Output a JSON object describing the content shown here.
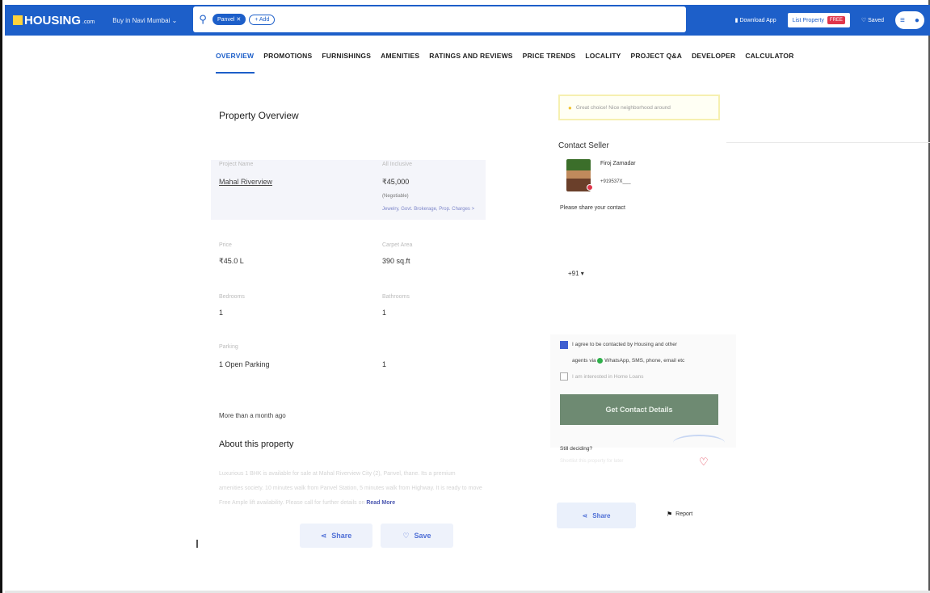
{
  "header": {
    "logo": "HOUSING",
    "logo_suffix": ".com",
    "city_selector": "Buy in Navi Mumbai",
    "search_chip": "Panvel",
    "search_add": "+ Add",
    "download_app": "Download App",
    "list_property": "List Property",
    "free_badge": "FREE",
    "saved": "Saved",
    "menu_icon": "hamburger-icon",
    "profile_icon": "user-icon"
  },
  "tabs": [
    "OVERVIEW",
    "PROMOTIONS",
    "FURNISHINGS",
    "AMENITIES",
    "RATINGS AND REVIEWS",
    "PRICE TRENDS",
    "LOCALITY",
    "PROJECT Q&A",
    "DEVELOPER",
    "CALCULATOR"
  ],
  "overview": {
    "title": "Property Overview",
    "project_name_label": "Project Name",
    "project_name": "Mahal Riverview",
    "price_label": "All Inclusive",
    "price_value": "₹45,000",
    "price_note": "(Negotiable)",
    "price_link": "Jewelry, Govt. Brokerage, Prop. Charges >",
    "price_range_label": "Price",
    "price_lakh": "₹45.0 L",
    "area_label": "Carpet Area",
    "area_value": "390 sq.ft",
    "bedrooms_label": "Bedrooms",
    "bedrooms_value": "1",
    "bathrooms_label": "Bathrooms",
    "bathrooms_value": "1",
    "parking_label": "Parking",
    "parking_value": "1 Open Parking",
    "extra_value": "1",
    "posted": "More than a month ago"
  },
  "about": {
    "title": "About this property",
    "text_line1": "Luxurious 1 BHK is available for sale at Mahal Riverview City (2), Panvel, thane. Its a premium",
    "text_line2": "amenities society. 10 minutes walk from Panvel Station, 5 minutes walk from Highway. It is ready to move",
    "text_line3": "Free Ample lift availability. Please call for further details on",
    "read_more": "Read More",
    "share": "Share",
    "save": "Save"
  },
  "contact": {
    "hint": "Great choice! Nice neighborhood around",
    "title": "Contact Seller",
    "seller_name": "Firoj Zamadar",
    "seller_phone": "+919537X___",
    "share_prompt": "Please share your contact",
    "country_code": "+91 ▾",
    "consent_line1": "I agree to be contacted by Housing and other",
    "consent_line2": "agents via",
    "consent_line2b": "WhatsApp, SMS, phone, email etc",
    "home_loans": "I am interested in Home Loans",
    "cta": "Get Contact Details",
    "still_deciding": "Still deciding?",
    "still_sub": "Shortlist this property for later",
    "share": "Share",
    "report": "Report"
  }
}
